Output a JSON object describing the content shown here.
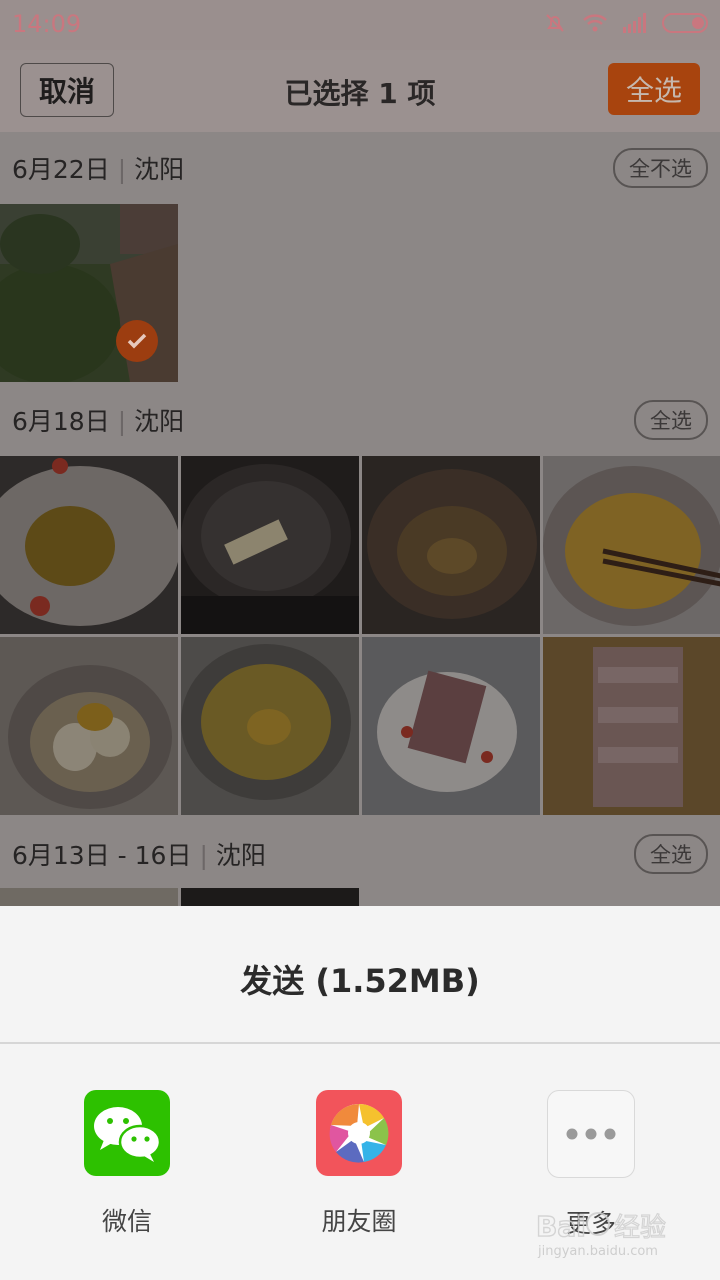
{
  "status_bar": {
    "time": "14:09",
    "icons": [
      "mute-bell-icon",
      "wifi-icon",
      "signal-icon",
      "battery-icon"
    ],
    "accent": "#c9777f"
  },
  "header": {
    "cancel_label": "取消",
    "title": "已选择 1 项",
    "select_all_label": "全选",
    "accent": "#a8440e"
  },
  "sections": [
    {
      "date": "6月22日",
      "city": "沈阳",
      "toggle_label": "全不选"
    },
    {
      "date": "6月18日",
      "city": "沈阳",
      "toggle_label": "全选"
    },
    {
      "date": "6月13日 - 16日",
      "city": "沈阳",
      "toggle_label": "全选"
    }
  ],
  "photos": {
    "section1": [
      {
        "subject": "garden path",
        "selected": true
      }
    ],
    "section2": [
      {
        "subject": "fried food on plate",
        "selected": false
      },
      {
        "subject": "wok with frying strips",
        "selected": false
      },
      {
        "subject": "empty wok",
        "selected": false
      },
      {
        "subject": "bowl with batter and chopsticks",
        "selected": false
      },
      {
        "subject": "bowl with egg and flour",
        "selected": false
      },
      {
        "subject": "bowl with egg",
        "selected": false
      },
      {
        "subject": "plate of raw meat",
        "selected": false
      },
      {
        "subject": "meat strips on cutting board",
        "selected": false
      }
    ]
  },
  "share_sheet": {
    "title": "发送 (1.52MB)",
    "items": [
      {
        "label": "微信",
        "icon": "wechat-icon",
        "color": "#2dc100"
      },
      {
        "label": "朋友圈",
        "icon": "moments-icon",
        "color": "#f2545b"
      },
      {
        "label": "更多",
        "icon": "more-icon",
        "color": "#f7f7f7"
      }
    ]
  },
  "watermark": {
    "text": "Bai经验",
    "url_text": "jingyan.baidu.com"
  }
}
